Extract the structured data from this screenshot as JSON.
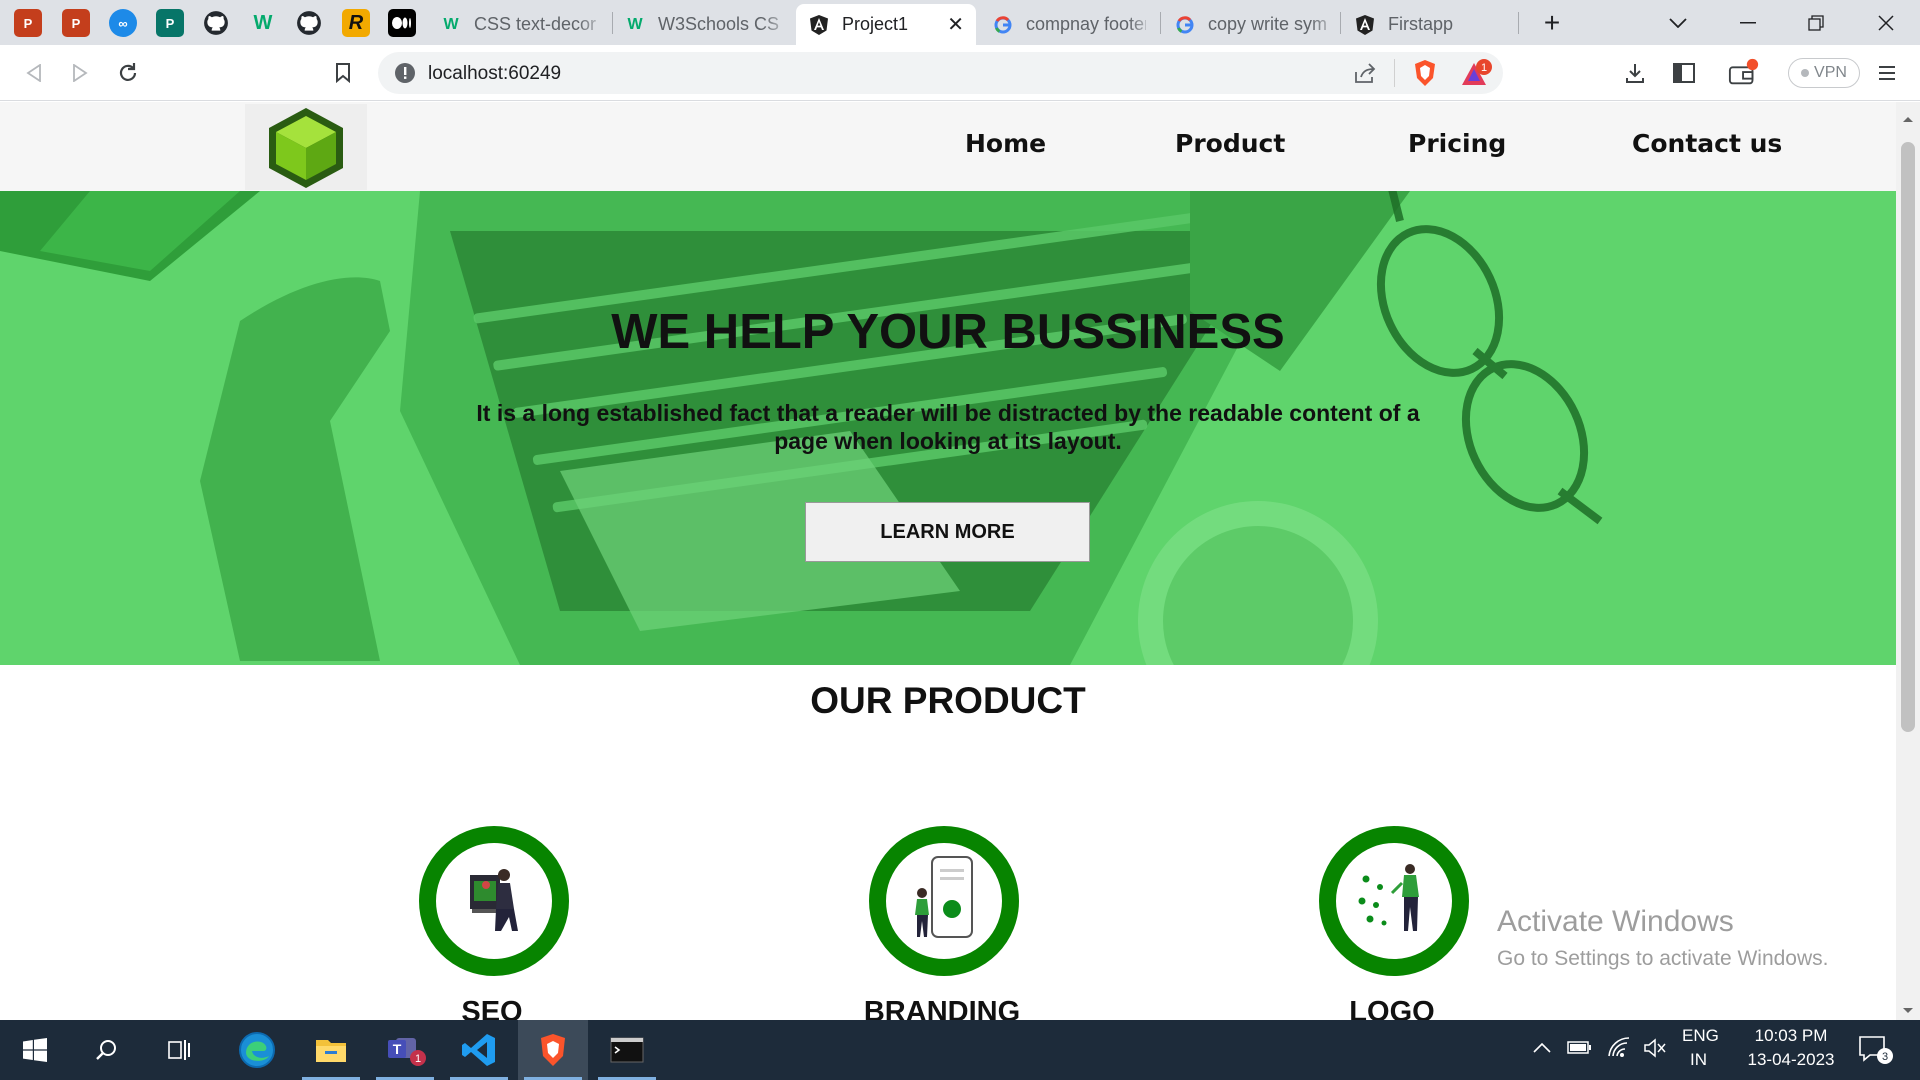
{
  "browser": {
    "pinned_tabs": [
      {
        "icon": "powerpoint-icon",
        "color": "#c43e1c",
        "glyph": "P"
      },
      {
        "icon": "powerpoint-icon",
        "color": "#c43e1c",
        "glyph": "P"
      },
      {
        "icon": "codeninja-icon",
        "color": "#1d8ae8",
        "glyph": "∞"
      },
      {
        "icon": "microsoft-publisher-icon",
        "color": "#077568",
        "glyph": "P"
      },
      {
        "icon": "github-icon",
        "color": "#24292f",
        "glyph": "●"
      },
      {
        "icon": "w3schools-icon",
        "color": "#04aa6d",
        "glyph": "W"
      },
      {
        "icon": "github-icon",
        "color": "#24292f",
        "glyph": "●"
      },
      {
        "icon": "r-icon",
        "color": "#f2a900",
        "glyph": "R"
      },
      {
        "icon": "medium-icon",
        "color": "#000000",
        "glyph": "●●"
      }
    ],
    "tabs": [
      {
        "title": "CSS text-decora",
        "icon": "w3schools-icon"
      },
      {
        "title": "W3Schools CSS",
        "icon": "w3schools-icon"
      },
      {
        "title": "Project1",
        "icon": "angular-icon",
        "active": true
      },
      {
        "title": "compnay footer",
        "icon": "google-icon"
      },
      {
        "title": "copy write symb",
        "icon": "google-icon"
      },
      {
        "title": "Firstapp",
        "icon": "angular-icon"
      }
    ],
    "url": "localhost:60249",
    "brave_badge": "1",
    "vpn_label": "VPN"
  },
  "site": {
    "nav": [
      "Home",
      "Product",
      "Pricing",
      "Contact us"
    ],
    "hero": {
      "title": "WE HELP YOUR BUSSINESS",
      "text": "It is a long established fact that a reader will be distracted by the readable content of a page when looking at its layout.",
      "button": "LEARN MORE"
    },
    "product_heading": "OUR PRODUCT",
    "products": [
      {
        "label": "SEO",
        "icon": "seo-illustration-icon"
      },
      {
        "label": "BRANDING",
        "icon": "branding-illustration-icon"
      },
      {
        "label": "LOGO",
        "icon": "logo-illustration-icon"
      }
    ],
    "brand_color": "#078400",
    "hero_overlay_color": "#5fd46c"
  },
  "watermark": {
    "title": "Activate Windows",
    "subtitle": "Go to Settings to activate Windows."
  },
  "taskbar": {
    "apps": [
      "start-icon",
      "search-icon",
      "task-view-icon",
      "edge-icon",
      "file-explorer-icon",
      "teams-icon",
      "vscode-icon",
      "brave-icon",
      "terminal-icon"
    ],
    "teams_badge": "1",
    "lang_top": "ENG",
    "lang_bottom": "IN",
    "time": "10:03 PM",
    "date": "13-04-2023",
    "notifications": "3"
  }
}
